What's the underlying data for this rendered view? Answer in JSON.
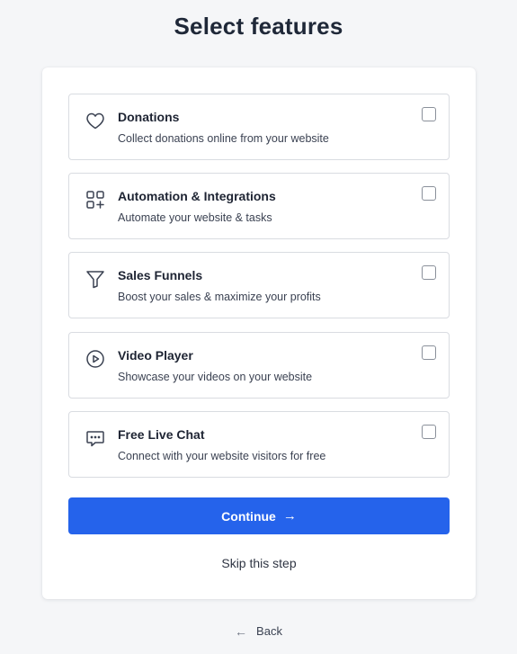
{
  "page": {
    "title": "Select features"
  },
  "features": [
    {
      "icon": "heart-icon",
      "title": "Donations",
      "description": "Collect donations online from your website"
    },
    {
      "icon": "apps-plus-icon",
      "title": "Automation & Integrations",
      "description": "Automate your website & tasks"
    },
    {
      "icon": "funnel-icon",
      "title": "Sales Funnels",
      "description": "Boost your sales & maximize your profits"
    },
    {
      "icon": "play-circle-icon",
      "title": "Video Player",
      "description": "Showcase your videos on your website"
    },
    {
      "icon": "chat-bubble-icon",
      "title": "Free Live Chat",
      "description": "Connect with your website visitors for free"
    }
  ],
  "actions": {
    "continue_label": "Continue",
    "continue_arrow": "→",
    "skip_label": "Skip this step",
    "back_arrow": "←",
    "back_label": "Back"
  },
  "colors": {
    "primary": "#2563eb",
    "background": "#f5f6f8",
    "card": "#ffffff",
    "border": "#d9dce1"
  }
}
